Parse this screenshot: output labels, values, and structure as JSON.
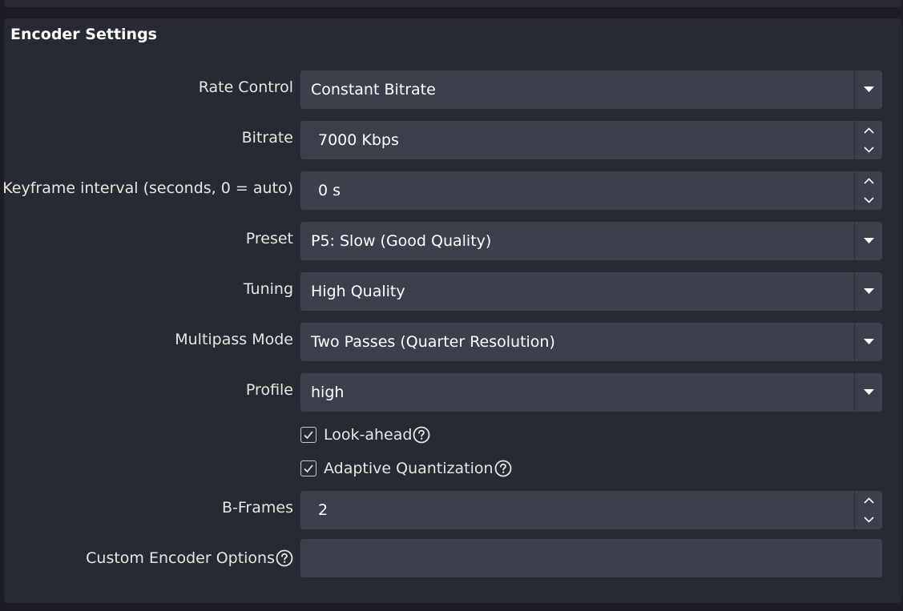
{
  "panel": {
    "title": "Encoder Settings"
  },
  "rows": {
    "rate_control": {
      "label": "Rate Control",
      "value": "Constant Bitrate"
    },
    "bitrate": {
      "label": "Bitrate",
      "value": "7000 Kbps"
    },
    "keyframe": {
      "label": "Keyframe interval (seconds, 0 = auto)",
      "value": "0 s"
    },
    "preset": {
      "label": "Preset",
      "value": "P5: Slow (Good Quality)"
    },
    "tuning": {
      "label": "Tuning",
      "value": "High Quality"
    },
    "multipass": {
      "label": "Multipass Mode",
      "value": "Two Passes (Quarter Resolution)"
    },
    "profile": {
      "label": "Profile",
      "value": "high"
    },
    "look_ahead": {
      "label": "Look-ahead",
      "checked": true
    },
    "adaptive_quant": {
      "label": "Adaptive Quantization",
      "checked": true
    },
    "bframes": {
      "label": "B-Frames",
      "value": "2"
    },
    "custom_options": {
      "label": "Custom Encoder Options",
      "value": ""
    }
  },
  "icons": {
    "dropdown": "chevron-down-icon",
    "spin_up": "chevron-up-icon",
    "spin_down": "chevron-down-icon",
    "help": "help-icon",
    "check": "check-icon"
  },
  "colors": {
    "background": "#1d1e25",
    "panel": "#272a33",
    "field": "#3c404d",
    "text": "#e6e6e6"
  }
}
